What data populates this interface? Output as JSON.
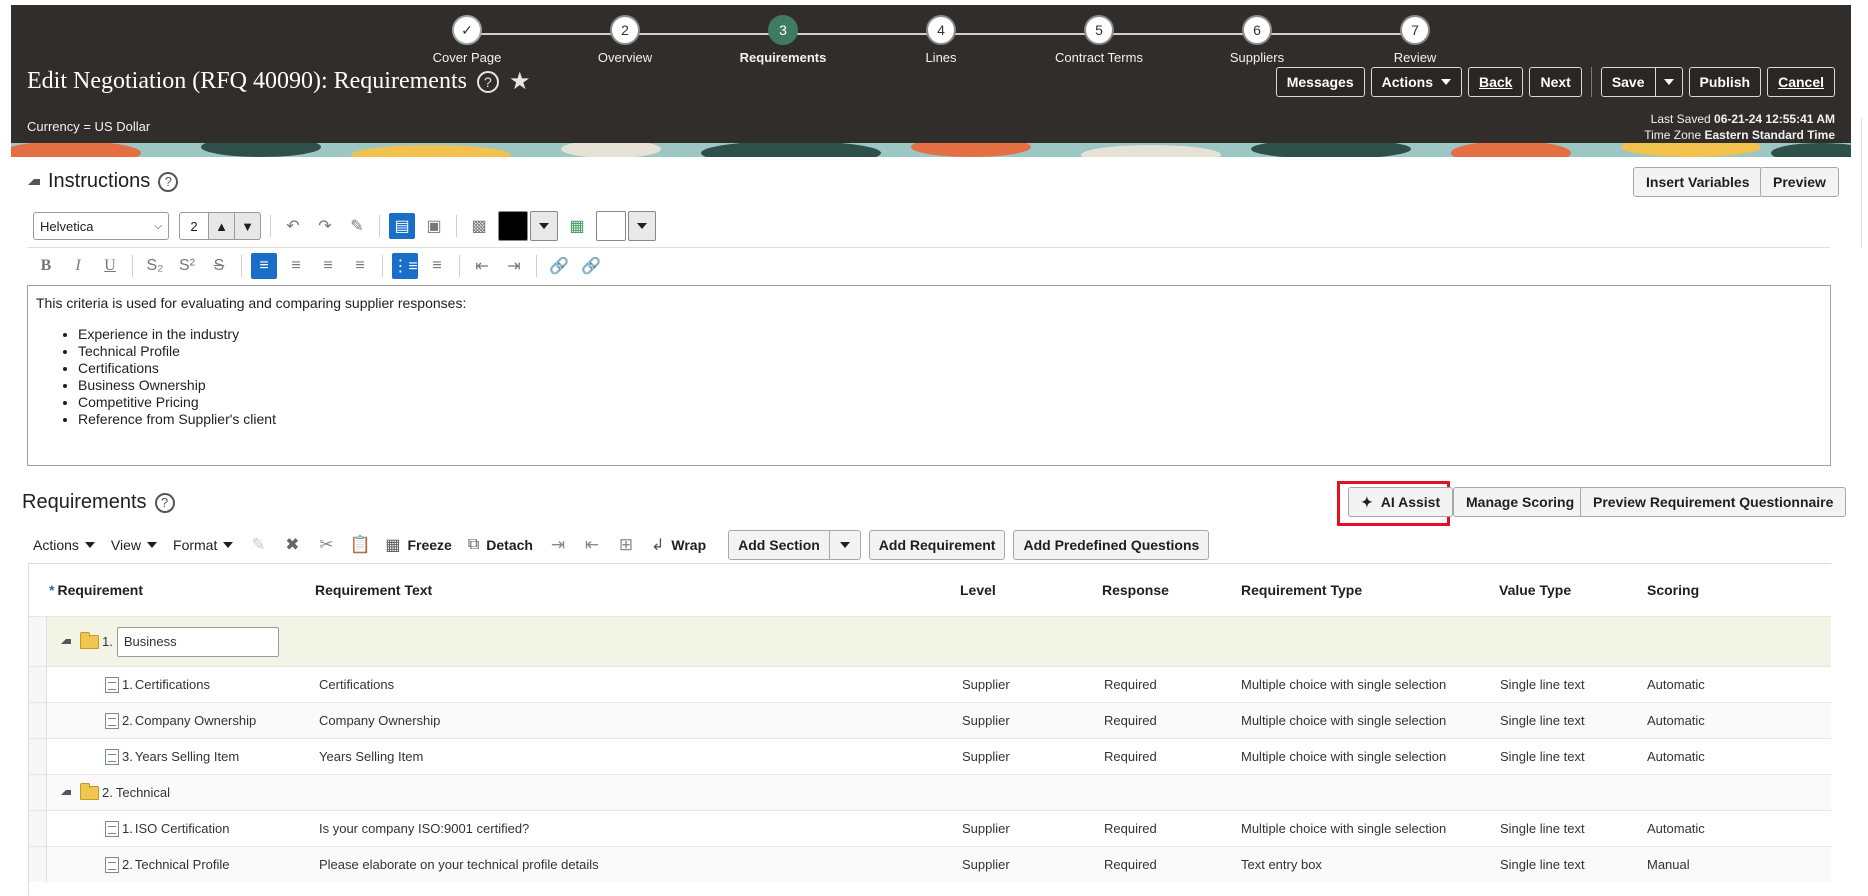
{
  "header": {
    "title": "Edit Negotiation (RFQ 40090): Requirements",
    "currency": "Currency = US Dollar",
    "last_saved_label": "Last Saved",
    "last_saved_value": "06-21-24 12:55:41 AM",
    "time_zone_label": "Time Zone",
    "time_zone_value": "Eastern Standard Time",
    "buttons": {
      "messages": "Messages",
      "actions": "Actions",
      "back": "Back",
      "next": "Next",
      "save": "Save",
      "publish": "Publish",
      "cancel": "Cancel"
    }
  },
  "train": [
    {
      "num": "✓",
      "label": "Cover Page"
    },
    {
      "num": "2",
      "label": "Overview"
    },
    {
      "num": "3",
      "label": "Requirements"
    },
    {
      "num": "4",
      "label": "Lines"
    },
    {
      "num": "5",
      "label": "Contract Terms"
    },
    {
      "num": "6",
      "label": "Suppliers"
    },
    {
      "num": "7",
      "label": "Review"
    }
  ],
  "instructions": {
    "heading": "Instructions",
    "insert_variables": "Insert Variables",
    "preview": "Preview",
    "font": "Helvetica",
    "font_size": "2",
    "intro": "This criteria is used for evaluating and comparing supplier responses:",
    "bullets": [
      "Experience in the industry",
      "Technical Profile",
      "Certifications",
      "Business Ownership",
      "Competitive Pricing",
      "Reference from Supplier's client"
    ]
  },
  "requirements": {
    "heading": "Requirements",
    "ai_assist": "AI Assist",
    "manage_scoring": "Manage Scoring",
    "preview_questionnaire": "Preview Requirement Questionnaire",
    "toolbar": {
      "actions": "Actions",
      "view": "View",
      "format": "Format",
      "freeze": "Freeze",
      "detach": "Detach",
      "wrap": "Wrap",
      "add_section": "Add Section",
      "add_requirement": "Add Requirement",
      "add_predefined": "Add Predefined Questions"
    },
    "columns": {
      "required_marker": "*",
      "requirement": "Requirement",
      "text": "Requirement Text",
      "level": "Level",
      "response": "Response",
      "type": "Requirement Type",
      "value_type": "Value Type",
      "scoring": "Scoring"
    },
    "sections": [
      {
        "number": "1.",
        "name": "Business",
        "rows": [
          {
            "num": "1.",
            "name": "Certifications",
            "text": "Certifications",
            "level": "Supplier",
            "response": "Required",
            "type": "Multiple choice with single selection",
            "value_type": "Single line text",
            "scoring": "Automatic"
          },
          {
            "num": "2.",
            "name": "Company Ownership",
            "text": "Company Ownership",
            "level": "Supplier",
            "response": "Required",
            "type": "Multiple choice with single selection",
            "value_type": "Single line text",
            "scoring": "Automatic"
          },
          {
            "num": "3.",
            "name": "Years Selling Item",
            "text": "Years Selling Item",
            "level": "Supplier",
            "response": "Required",
            "type": "Multiple choice with single selection",
            "value_type": "Single line text",
            "scoring": "Automatic"
          }
        ]
      },
      {
        "number": "2.",
        "name": "Technical",
        "rows": [
          {
            "num": "1.",
            "name": "ISO Certification",
            "text": "Is your company ISO:9001 certified?",
            "level": "Supplier",
            "response": "Required",
            "type": "Multiple choice with single selection",
            "value_type": "Single line text",
            "scoring": "Automatic"
          },
          {
            "num": "2.",
            "name": "Technical Profile",
            "text": "Please elaborate on your technical profile details",
            "level": "Supplier",
            "response": "Required",
            "type": "Text entry box",
            "value_type": "Single line text",
            "scoring": "Manual"
          }
        ]
      }
    ]
  }
}
